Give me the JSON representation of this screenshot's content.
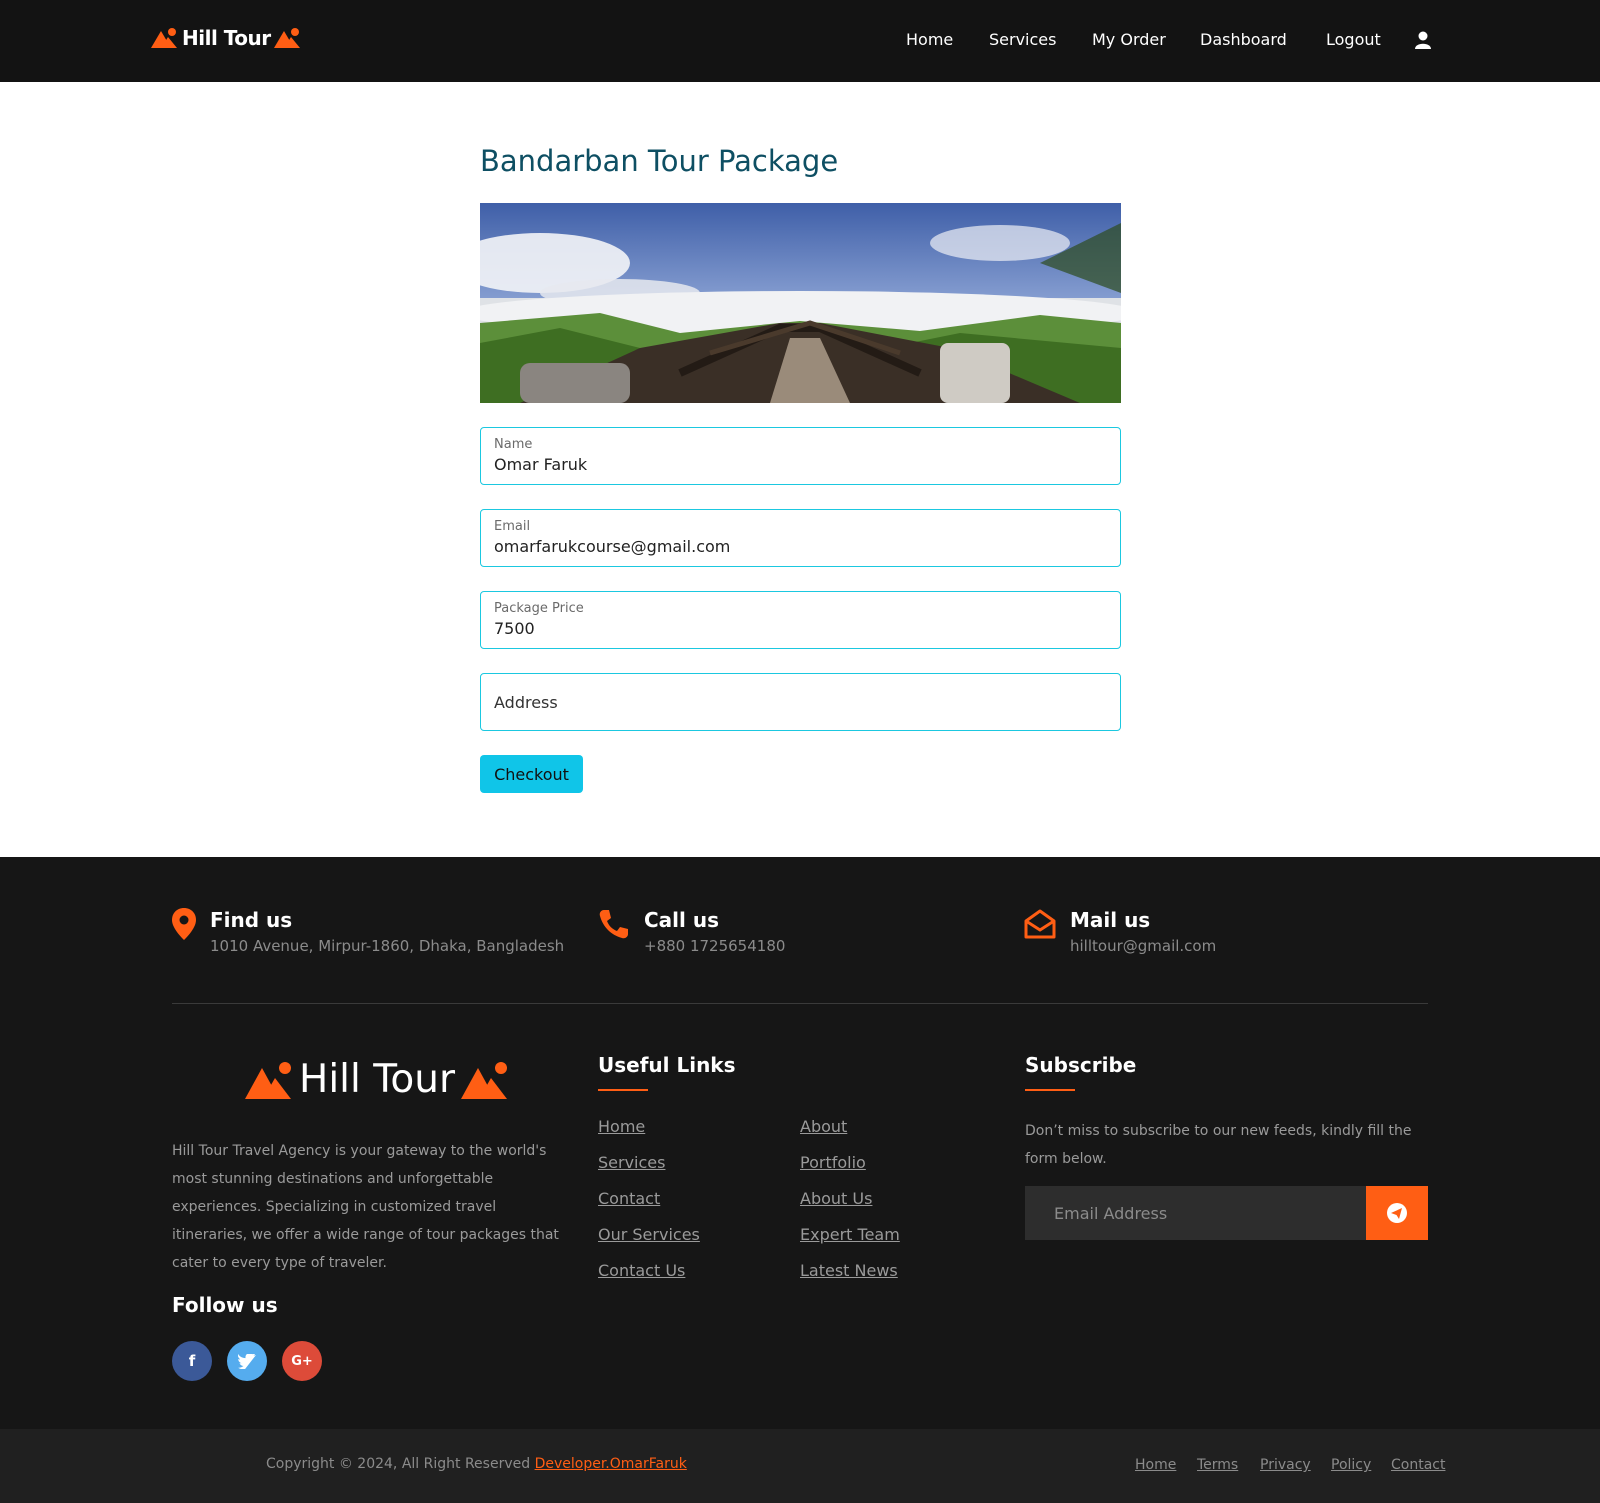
{
  "nav": {
    "brand": "Hill Tour",
    "links": [
      "Home",
      "Services",
      "My Order",
      "Dashboard",
      "Logout"
    ]
  },
  "main": {
    "title": "Bandarban Tour Package",
    "fields": [
      {
        "label": "Name",
        "value": "Omar Faruk"
      },
      {
        "label": "Email",
        "value": "omarfarukcourse@gmail.com"
      },
      {
        "label": "Package Price",
        "value": "7500"
      }
    ],
    "address_placeholder": "Address",
    "checkout_label": "Checkout"
  },
  "contacts": [
    {
      "title": "Find us",
      "detail": "1010 Avenue, Mirpur-1860, Dhaka, Bangladesh"
    },
    {
      "title": "Call us",
      "detail": "+880 1725654180"
    },
    {
      "title": "Mail us",
      "detail": "hilltour@gmail.com"
    }
  ],
  "footer": {
    "brand": "Hill Tour",
    "about": "Hill Tour Travel Agency is your gateway to the world's most stunning destinations and unforgettable experiences. Specializing in customized travel itineraries, we offer a wide range of tour packages that cater to every type of traveler.",
    "follow_title": "Follow us",
    "social": [
      "f",
      "t",
      "G+"
    ],
    "useful_title": "Useful Links",
    "links_left": [
      "Home",
      "Services",
      "Contact",
      "Our Services",
      "Contact Us"
    ],
    "links_right": [
      "About",
      "Portfolio",
      "About Us",
      "Expert Team",
      "Latest News"
    ],
    "subscribe_title": "Subscribe",
    "subscribe_text": "Don’t miss to subscribe to our new feeds, kindly fill the form below.",
    "subscribe_placeholder": "Email Address"
  },
  "copyright": {
    "text": "Copyright © 2024, All Right Reserved ",
    "developer": "Developer.OmarFaruk",
    "links": [
      "Home",
      "Terms",
      "Privacy",
      "Policy",
      "Contact"
    ]
  },
  "colors": {
    "accent": "#ff5e14",
    "cyan": "#10c5e8",
    "title": "#0e4f63"
  }
}
